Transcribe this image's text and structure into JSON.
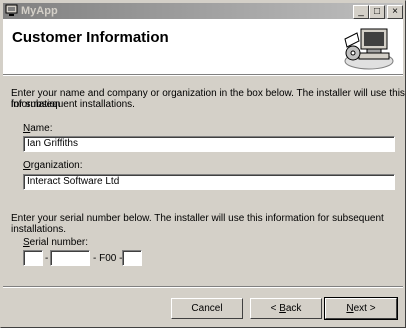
{
  "titlebar": {
    "title": "MyApp",
    "minimize": "_",
    "maximize": "□",
    "close": "×"
  },
  "header": {
    "title": "Customer Information"
  },
  "instructions": {
    "line1": "Enter your name and company or organization in the box below. The installer will use this information",
    "line2": "for subsequent installations."
  },
  "name": {
    "label_accel": "N",
    "label_rest": "ame:",
    "value": "Ian Griffiths"
  },
  "organization": {
    "label_accel": "O",
    "label_rest": "rganization:",
    "value": "Interact Software Ltd"
  },
  "serial_instructions": "Enter your serial number below. The installer will use this information for subsequent installations.",
  "serial": {
    "label_accel": "S",
    "label_rest": "erial number:",
    "separator1": "-",
    "separator2": "- F00 -",
    "part1": "",
    "part2": "",
    "part3": ""
  },
  "buttons": {
    "cancel": "Cancel",
    "back_prefix": "< ",
    "back_accel": "B",
    "back_rest": "ack",
    "next_accel": "N",
    "next_rest": "ext >"
  }
}
